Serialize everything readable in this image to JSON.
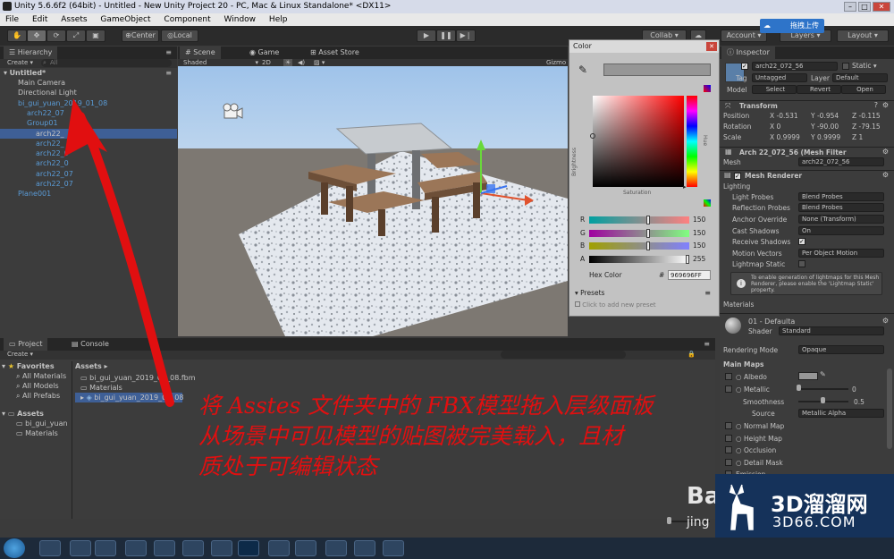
{
  "window": {
    "title": "Unity 5.6.6f2 (64bit) - Untitled - New Unity Project 20 - PC, Mac & Linux Standalone* <DX11>"
  },
  "menu": [
    "File",
    "Edit",
    "Assets",
    "GameObject",
    "Component",
    "Window",
    "Help"
  ],
  "toolbar": {
    "pivot": "Center",
    "space": "Local",
    "collab": "Collab",
    "account": "Account",
    "layers": "Layers",
    "layout": "Layout",
    "upload": "拖拽上传"
  },
  "hierarchy": {
    "tab": "Hierarchy",
    "create": "Create",
    "search": "All",
    "scene_name": "Untitled*",
    "items": [
      {
        "label": "Main Camera",
        "indent": 0,
        "blue": false,
        "selected": false
      },
      {
        "label": "Directional Light",
        "indent": 0,
        "blue": false,
        "selected": false
      },
      {
        "label": "bi_gui_yuan_2019_01_08",
        "indent": 0,
        "blue": true,
        "selected": false
      },
      {
        "label": "arch22_07",
        "indent": 1,
        "blue": true,
        "selected": false
      },
      {
        "label": "Group01",
        "indent": 1,
        "blue": true,
        "selected": false
      },
      {
        "label": "arch22_",
        "indent": 2,
        "blue": false,
        "selected": true
      },
      {
        "label": "arch22_",
        "indent": 2,
        "blue": true,
        "selected": false
      },
      {
        "label": "arch22_0",
        "indent": 2,
        "blue": true,
        "selected": false
      },
      {
        "label": "arch22_0",
        "indent": 2,
        "blue": true,
        "selected": false
      },
      {
        "label": "arch22_07",
        "indent": 2,
        "blue": true,
        "selected": false
      },
      {
        "label": "arch22_07",
        "indent": 2,
        "blue": true,
        "selected": false
      },
      {
        "label": "Plane001",
        "indent": 0,
        "blue": true,
        "selected": false
      }
    ]
  },
  "scene_view": {
    "tabs": [
      "Scene",
      "Game",
      "Asset Store"
    ],
    "shading": "Shaded",
    "mode": "2D",
    "gizmos": "Gizmo"
  },
  "color_picker": {
    "title": "Color",
    "brightness": "Brightness",
    "saturation": "Saturation",
    "hue": "Hue",
    "channels": [
      {
        "name": "R",
        "value": "150"
      },
      {
        "name": "G",
        "value": "150"
      },
      {
        "name": "B",
        "value": "150"
      },
      {
        "name": "A",
        "value": "255"
      }
    ],
    "hex_label": "Hex Color",
    "hex_hash": "#",
    "hex_value": "969696FF",
    "presets": "Presets",
    "add_preset": "Click to add new preset"
  },
  "inspector": {
    "tab": "Inspector",
    "object_name": "arch22_072_56",
    "static": "Static",
    "tag_label": "Tag",
    "tag": "Untagged",
    "layer_label": "Layer",
    "layer": "Default",
    "model_label": "Model",
    "select": "Select",
    "revert": "Revert",
    "open": "Open",
    "transform": "Transform",
    "position_label": "Position",
    "position": [
      "X -0.531",
      "Y -0.954",
      "Z -0.115"
    ],
    "rotation_label": "Rotation",
    "rotation": [
      "X 0",
      "Y -90.00",
      "Z -79.15"
    ],
    "scale_label": "Scale",
    "scale": [
      "X 0.9999",
      "Y 0.9999",
      "Z 1"
    ],
    "mesh_filter": "Arch 22_072_56 (Mesh Filter",
    "mesh_label": "Mesh",
    "mesh_value": "arch22_072_56",
    "mesh_renderer": "Mesh Renderer",
    "lighting": "Lighting",
    "light_probes_label": "Light Probes",
    "light_probes": "Blend Probes",
    "reflection_probes_label": "Reflection Probes",
    "reflection_probes": "Blend Probes",
    "anchor_override_label": "Anchor Override",
    "anchor_override": "None (Transform)",
    "cast_shadows_label": "Cast Shadows",
    "cast_shadows": "On",
    "receive_shadows_label": "Receive Shadows",
    "motion_vectors_label": "Motion Vectors",
    "motion_vectors": "Per Object Motion",
    "lightmap_static_label": "Lightmap Static",
    "lightmap_info": "To enable generation of lightmaps for this Mesh Renderer, please enable the 'Lightmap Static' property.",
    "materials": "Materials",
    "material_name": "01 - Defaulta",
    "shader_label": "Shader",
    "shader": "Standard",
    "rendering_mode_label": "Rendering Mode",
    "rendering_mode": "Opaque",
    "main_maps": "Main Maps",
    "albedo": "Albedo",
    "metallic": "Metallic",
    "metallic_value": "0",
    "smoothness": "Smoothness",
    "smoothness_value": "0.5",
    "source_label": "Source",
    "source": "Metallic Alpha",
    "normal_map": "Normal Map",
    "height_map": "Height Map",
    "occlusion": "Occlusion",
    "detail_mask": "Detail Mask",
    "emission": "Emission"
  },
  "project": {
    "tabs": [
      "Project",
      "Console"
    ],
    "create": "Create",
    "favorites": "Favorites",
    "favorite_items": [
      "All Materials",
      "All Models",
      "All Prefabs"
    ],
    "assets_root": "Assets",
    "asset_tree": [
      "bi_gui_yuan",
      "Materials"
    ],
    "breadcrumb": "Assets",
    "files": [
      "bi_gui_yuan_2019_01_08.fbm",
      "Materials",
      "bi_gui_yuan_2019_01_08"
    ]
  },
  "annotation": {
    "lines": [
      "将 Asstes 文件夹中的 FBX模型拖入层级面板",
      "从场景中可见模型的贴图被完美载入，且材",
      "质处于可编辑状态"
    ]
  },
  "watermark": {
    "brand": "3D溜溜网",
    "domain": "3D66.COM",
    "baidu": "Ba",
    "baidu_sub": "jing"
  },
  "colors": {
    "annotation_red": "#e10f10",
    "selection_blue": "#3e5f96",
    "prefab_blue": "#5a9bd6"
  }
}
